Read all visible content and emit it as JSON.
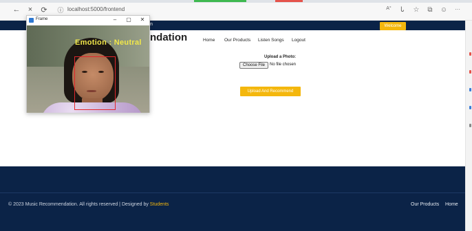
{
  "browser": {
    "url": "localhost:5000/frontend",
    "nav_back": "←",
    "nav_forward": "×",
    "nav_refresh": "⟳",
    "site_info": "ⓘ",
    "icons": [
      "read-aloud-icon",
      "font-icon",
      "favorite-icon",
      "collections-icon",
      "profile-icon",
      "more-icon"
    ],
    "icon_glyphs": [
      "A°",
      "Ꮣ",
      "☆",
      "⧉",
      "☺",
      "···"
    ]
  },
  "header": {
    "welcome_label": "Welcome",
    "brand_partial": "ndation",
    "header_partial": "n"
  },
  "nav": {
    "home": "Home",
    "products": "Our Products",
    "songs": "Listen Songs",
    "logout": "Logout"
  },
  "upload": {
    "label": "Upload a Photo:",
    "choose_button": "Choose File",
    "no_file": "No file chosen",
    "submit_button": "Upload And Recommend"
  },
  "footer": {
    "copyright_text": "© 2023 Music Recommendation. All rights reserved | Designed by ",
    "designer": "Students",
    "link_products": "Our Products",
    "link_home": "Home"
  },
  "webcam_window": {
    "title": "Frame",
    "minimize": "–",
    "maximize": "▢",
    "close": "✕",
    "emotion_text": "Emotion : Neutral"
  },
  "colors": {
    "navy": "#0b2347",
    "accent": "#f4b70d",
    "bbox": "#e3262b",
    "emotion_text": "#f2e84a"
  }
}
